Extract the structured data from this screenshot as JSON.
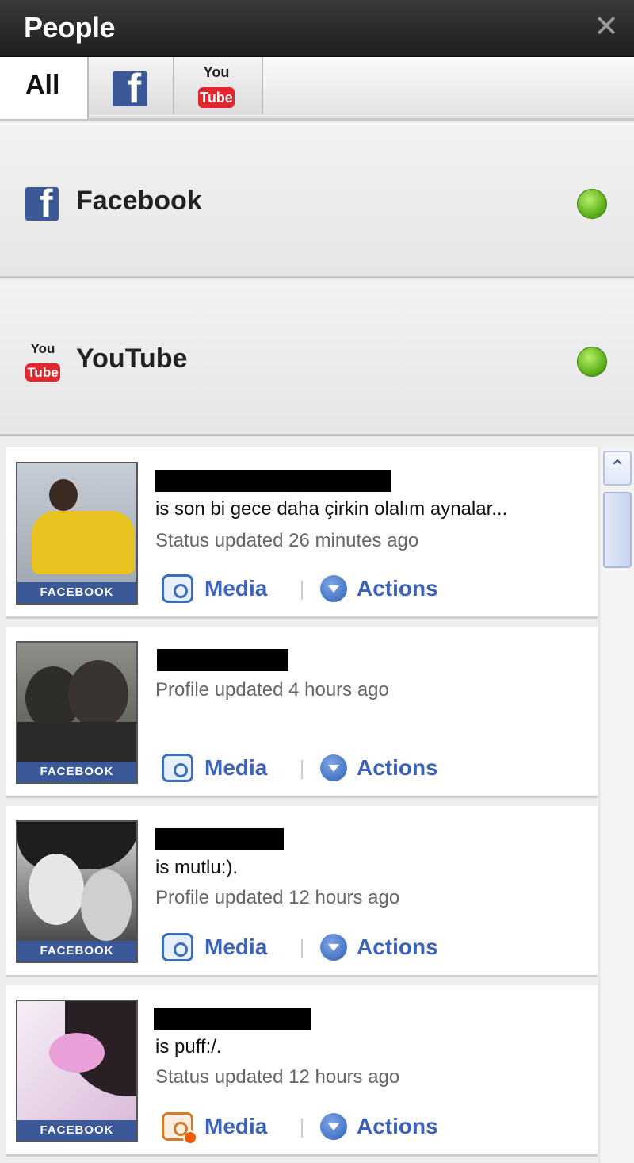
{
  "window": {
    "title": "People",
    "close_glyph": "✕"
  },
  "tabs": [
    {
      "label": "All",
      "active": true
    },
    {
      "icon": "facebook-icon",
      "active": false
    },
    {
      "icon": "youtube-icon",
      "active": false
    }
  ],
  "icons": {
    "youtube_top": "You",
    "youtube_bottom": "Tube"
  },
  "services": [
    {
      "name": "Facebook",
      "icon": "facebook-icon",
      "status_color": "#62b21c"
    },
    {
      "name": "YouTube",
      "icon": "youtube-icon",
      "status_color": "#62b21c"
    }
  ],
  "feed": {
    "items": [
      {
        "source": "FACEBOOK",
        "status": "is son bi gece daha çirkin olalım aynalar...",
        "time": "Status updated 26 minutes ago",
        "media_label": "Media",
        "actions_label": "Actions",
        "media_alert": false
      },
      {
        "source": "FACEBOOK",
        "status": "",
        "time": "Profile updated 4 hours ago",
        "media_label": "Media",
        "actions_label": "Actions",
        "media_alert": false
      },
      {
        "source": "FACEBOOK",
        "status": "is mutlu:).",
        "time": "Profile updated 12 hours ago",
        "media_label": "Media",
        "actions_label": "Actions",
        "media_alert": false
      },
      {
        "source": "FACEBOOK",
        "status": "is puff:/.",
        "time": "Status updated 12 hours ago",
        "media_label": "Media",
        "actions_label": "Actions",
        "media_alert": true
      }
    ]
  },
  "colors": {
    "facebook_blue": "#3b5998",
    "link_blue": "#3c63b7",
    "online_green": "#62b21c"
  }
}
